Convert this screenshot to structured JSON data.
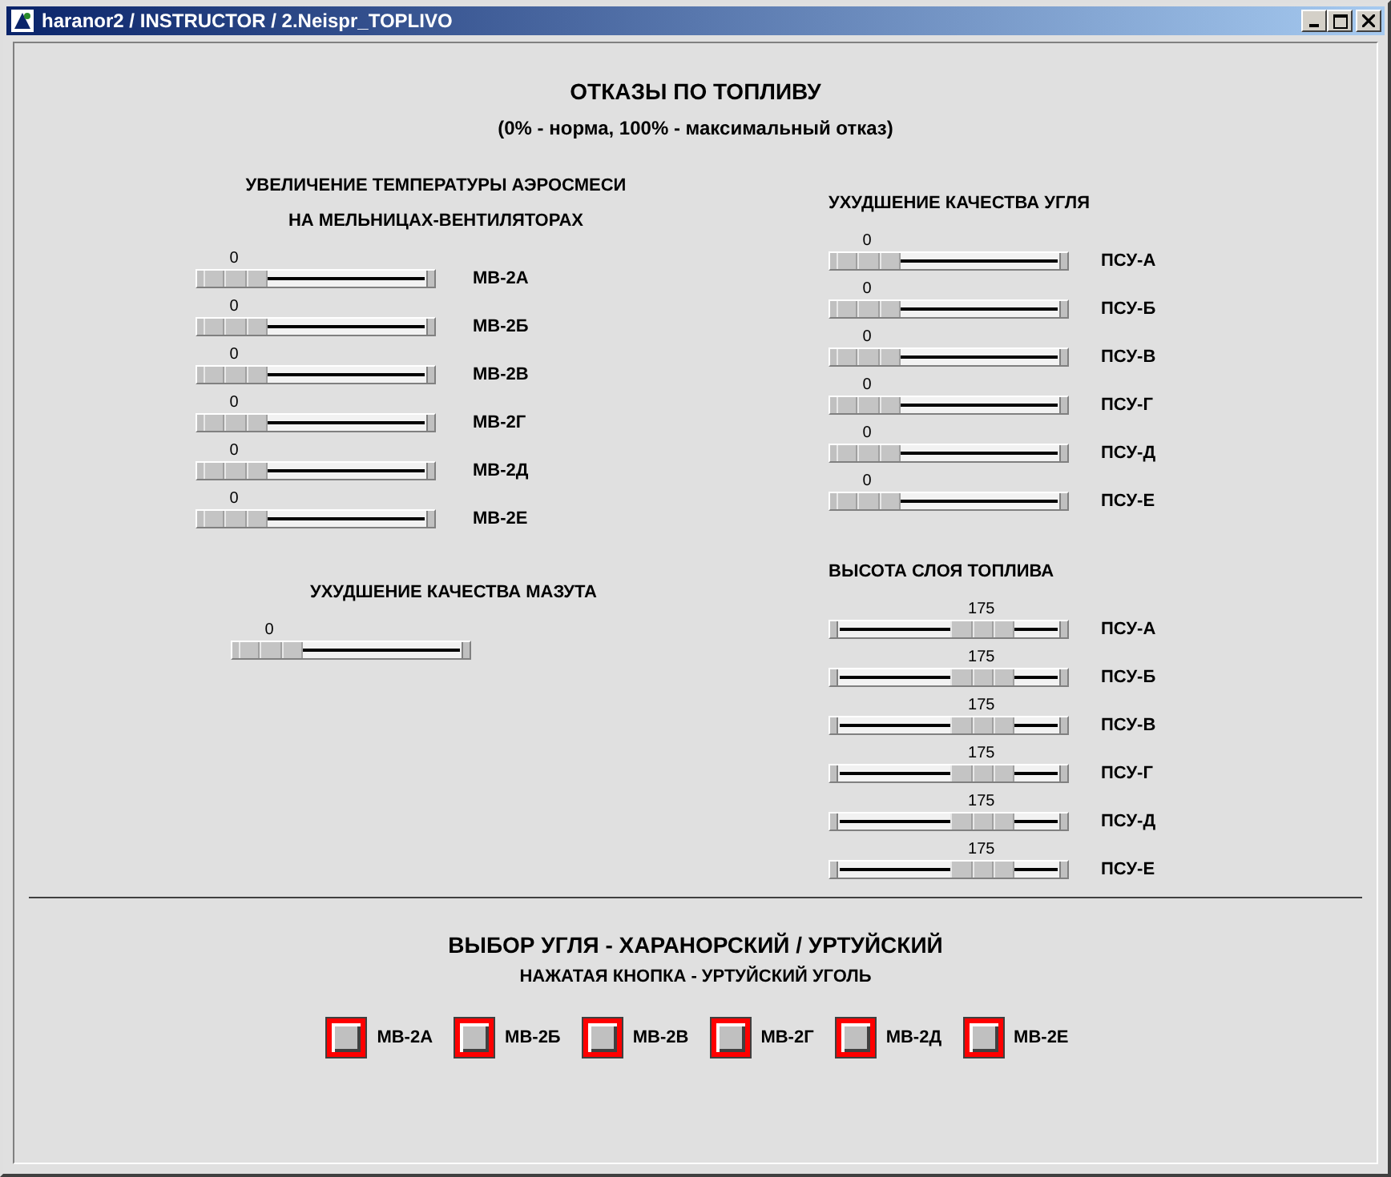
{
  "window": {
    "title": "haranor2 / INSTRUCTOR / 2.Neispr_TOPLIVO"
  },
  "heading": "ОТКАЗЫ ПО ТОПЛИВУ",
  "subheading": "(0% - норма, 100% - максимальный отказ)",
  "left_groups": [
    {
      "title_lines": [
        "УВЕЛИЧЕНИЕ ТЕМПЕРАТУРЫ АЭРОСМЕСИ",
        "НА МЕЛЬНИЦАХ-ВЕНТИЛЯТОРАХ"
      ],
      "sliders": [
        {
          "label": "МВ-2А",
          "value": "0",
          "level": 0
        },
        {
          "label": "МВ-2Б",
          "value": "0",
          "level": 0
        },
        {
          "label": "МВ-2В",
          "value": "0",
          "level": 0
        },
        {
          "label": "МВ-2Г",
          "value": "0",
          "level": 0
        },
        {
          "label": "МВ-2Д",
          "value": "0",
          "level": 0
        },
        {
          "label": "МВ-2Е",
          "value": "0",
          "level": 0
        }
      ]
    },
    {
      "title_lines": [
        "УХУДШЕНИЕ КАЧЕСТВА МАЗУТА"
      ],
      "sliders": [
        {
          "value": "0",
          "level": 0
        }
      ]
    }
  ],
  "right_groups": [
    {
      "title_lines": [
        "УХУДШЕНИЕ КАЧЕСТВА УГЛЯ"
      ],
      "sliders": [
        {
          "label": "ПСУ-А",
          "value": "0",
          "level": 0
        },
        {
          "label": "ПСУ-Б",
          "value": "0",
          "level": 0
        },
        {
          "label": "ПСУ-В",
          "value": "0",
          "level": 0
        },
        {
          "label": "ПСУ-Г",
          "value": "0",
          "level": 0
        },
        {
          "label": "ПСУ-Д",
          "value": "0",
          "level": 0
        },
        {
          "label": "ПСУ-Е",
          "value": "0",
          "level": 0
        }
      ]
    },
    {
      "title_lines": [
        "ВЫСОТА СЛОЯ ТОПЛИВА"
      ],
      "sliders": [
        {
          "label": "ПСУ-А",
          "value": "175",
          "level": 0.7
        },
        {
          "label": "ПСУ-Б",
          "value": "175",
          "level": 0.7
        },
        {
          "label": "ПСУ-В",
          "value": "175",
          "level": 0.7
        },
        {
          "label": "ПСУ-Г",
          "value": "175",
          "level": 0.7
        },
        {
          "label": "ПСУ-Д",
          "value": "175",
          "level": 0.7
        },
        {
          "label": "ПСУ-Е",
          "value": "175",
          "level": 0.7
        }
      ]
    }
  ],
  "coal_choice": {
    "title": "ВЫБОР УГЛЯ - ХАРАНОРСКИЙ / УРТУЙСКИЙ",
    "subtitle": "НАЖАТАЯ КНОПКА - УРТУЙСКИЙ УГОЛЬ",
    "buttons": [
      {
        "label": "МВ-2А",
        "pressed": false
      },
      {
        "label": "МВ-2Б",
        "pressed": false
      },
      {
        "label": "МВ-2В",
        "pressed": false
      },
      {
        "label": "МВ-2Г",
        "pressed": false
      },
      {
        "label": "МВ-2Д",
        "pressed": false
      },
      {
        "label": "МВ-2Е",
        "pressed": false
      }
    ]
  }
}
